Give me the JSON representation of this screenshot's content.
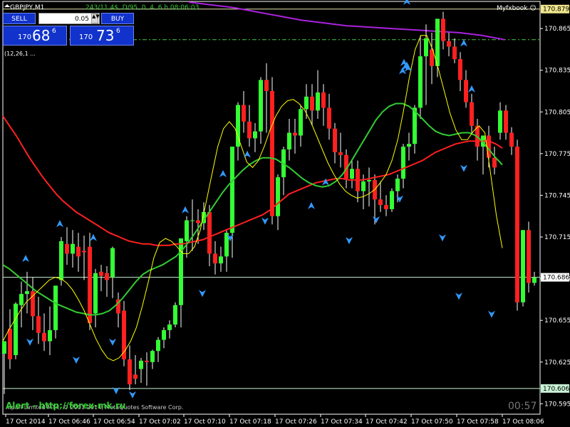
{
  "symbol_title": "GBPJPY,M1",
  "indicator_header": "243/11.4$, D/95,  0, 4, 6 h  08:06:03",
  "indicator_line2": "(12,26,1 ...",
  "account_label": "Myfxbook",
  "trade_panel": {
    "sell_label": "SELL",
    "buy_label": "BUY",
    "lot_value": "0.05",
    "sell_price_prefix": "170",
    "sell_price_big": "68",
    "sell_price_sup": "6",
    "buy_price_prefix": "170",
    "buy_price_big": "73",
    "buy_price_sup": "6"
  },
  "price_axis": {
    "ticks": [
      "170.865",
      "170.835",
      "170.805",
      "170.775",
      "170.745",
      "170.715",
      "170.685",
      "170.655",
      "170.625",
      "170.595"
    ],
    "ylim": [
      170.5875,
      170.8845
    ]
  },
  "price_tags": {
    "upper_line": "170.879",
    "current": "170.686",
    "lower_line": "170.606"
  },
  "time_axis": {
    "labels": [
      "17 Oct 2014",
      "17 Oct 06:46",
      "17 Oct 06:54",
      "17 Oct 07:02",
      "17 Oct 07:10",
      "17 Oct 07:18",
      "17 Oct 07:26",
      "17 Oct 07:34",
      "17 Oct 07:42",
      "17 Oct 07:50",
      "17 Oct 07:58",
      "17 Oct 08:06"
    ]
  },
  "alert_text": "Alert - http://forex-mk.ru",
  "copyright_text": "Alpari Limited MT4, © 2001-2014, MetaQuotes Software Corp.",
  "countdown": "00:57",
  "colors": {
    "bull": "#33ff33",
    "bear": "#ff2020",
    "wick": "#ffffff",
    "ma_slow": "#ff2020",
    "ma_mid": "#33cc33",
    "ma_fast": "#ffff00",
    "ma_long": "#aa22dd",
    "arrow": "#3399ff",
    "axis": "#ffffff",
    "level_line": "#c9f2d6",
    "lower_tag": "#c9f2d6",
    "bg": "#000000"
  },
  "chart_data": {
    "type": "candlestick",
    "symbol": "GBPJPY",
    "timeframe": "M1",
    "ylim": [
      170.5875,
      170.8845
    ],
    "candles": [
      {
        "o": 170.631,
        "h": 170.64,
        "c": 170.64,
        "l": 170.602
      },
      {
        "o": 170.649,
        "h": 170.663,
        "c": 170.627,
        "l": 170.62
      },
      {
        "o": 170.63,
        "h": 170.668,
        "c": 170.667,
        "l": 170.627
      },
      {
        "o": 170.666,
        "h": 170.683,
        "c": 170.674,
        "l": 170.65
      },
      {
        "o": 170.674,
        "h": 170.69,
        "c": 170.676,
        "l": 170.66
      },
      {
        "o": 170.676,
        "h": 170.686,
        "c": 170.658,
        "l": 170.648
      },
      {
        "o": 170.658,
        "h": 170.672,
        "c": 170.646,
        "l": 170.638
      },
      {
        "o": 170.646,
        "h": 170.66,
        "c": 170.64,
        "l": 170.633
      },
      {
        "o": 170.64,
        "h": 170.665,
        "c": 170.648,
        "l": 170.63
      },
      {
        "o": 170.648,
        "h": 170.67,
        "c": 170.68,
        "l": 170.642
      },
      {
        "o": 170.684,
        "h": 170.715,
        "c": 170.712,
        "l": 170.68
      },
      {
        "o": 170.71,
        "h": 170.722,
        "c": 170.703,
        "l": 170.695
      },
      {
        "o": 170.703,
        "h": 170.72,
        "c": 170.71,
        "l": 170.693
      },
      {
        "o": 170.708,
        "h": 170.718,
        "c": 170.701,
        "l": 170.69
      },
      {
        "o": 170.705,
        "h": 170.716,
        "c": 170.704,
        "l": 170.684
      },
      {
        "o": 170.708,
        "h": 170.718,
        "c": 170.653,
        "l": 170.648
      },
      {
        "o": 170.66,
        "h": 170.692,
        "c": 170.689,
        "l": 170.65
      },
      {
        "o": 170.69,
        "h": 170.695,
        "c": 170.687,
        "l": 170.676
      },
      {
        "o": 170.689,
        "h": 170.694,
        "c": 170.684,
        "l": 170.672
      },
      {
        "o": 170.686,
        "h": 170.708,
        "c": 170.707,
        "l": 170.671
      },
      {
        "o": 170.67,
        "h": 170.675,
        "c": 170.66,
        "l": 170.65
      },
      {
        "o": 170.662,
        "h": 170.669,
        "c": 170.627,
        "l": 170.622
      },
      {
        "o": 170.627,
        "h": 170.637,
        "c": 170.609,
        "l": 170.605
      },
      {
        "o": 170.616,
        "h": 170.63,
        "c": 170.613,
        "l": 170.609
      },
      {
        "o": 170.62,
        "h": 170.628,
        "c": 170.626,
        "l": 170.61
      },
      {
        "o": 170.626,
        "h": 170.632,
        "c": 170.625,
        "l": 170.608
      },
      {
        "o": 170.625,
        "h": 170.634,
        "c": 170.633,
        "l": 170.62
      },
      {
        "o": 170.633,
        "h": 170.643,
        "c": 170.641,
        "l": 170.625
      },
      {
        "o": 170.641,
        "h": 170.65,
        "c": 170.648,
        "l": 170.635
      },
      {
        "o": 170.648,
        "h": 170.655,
        "c": 170.652,
        "l": 170.642
      },
      {
        "o": 170.652,
        "h": 170.668,
        "c": 170.666,
        "l": 170.65
      },
      {
        "o": 170.666,
        "h": 170.714,
        "c": 170.714,
        "l": 170.65
      },
      {
        "o": 170.712,
        "h": 170.73,
        "c": 170.727,
        "l": 170.7
      },
      {
        "o": 170.727,
        "h": 170.742,
        "c": 170.727,
        "l": 170.705
      },
      {
        "o": 170.727,
        "h": 170.735,
        "c": 170.725,
        "l": 170.71
      },
      {
        "o": 170.725,
        "h": 170.74,
        "c": 170.733,
        "l": 170.72
      },
      {
        "o": 170.733,
        "h": 170.738,
        "c": 170.703,
        "l": 170.694
      },
      {
        "o": 170.703,
        "h": 170.712,
        "c": 170.696,
        "l": 170.688
      },
      {
        "o": 170.696,
        "h": 170.708,
        "c": 170.701,
        "l": 170.69
      },
      {
        "o": 170.701,
        "h": 170.72,
        "c": 170.718,
        "l": 170.69
      },
      {
        "o": 170.718,
        "h": 170.78,
        "c": 170.78,
        "l": 170.7
      },
      {
        "o": 170.78,
        "h": 170.812,
        "c": 170.81,
        "l": 170.77
      },
      {
        "o": 170.81,
        "h": 170.82,
        "c": 170.798,
        "l": 170.79
      },
      {
        "o": 170.798,
        "h": 170.81,
        "c": 170.786,
        "l": 170.78
      },
      {
        "o": 170.786,
        "h": 170.797,
        "c": 170.791,
        "l": 170.776
      },
      {
        "o": 170.791,
        "h": 170.83,
        "c": 170.828,
        "l": 170.782
      },
      {
        "o": 170.828,
        "h": 170.84,
        "c": 170.82,
        "l": 170.79
      },
      {
        "o": 170.82,
        "h": 170.83,
        "c": 170.73,
        "l": 170.724
      },
      {
        "o": 170.73,
        "h": 170.76,
        "c": 170.758,
        "l": 170.72
      },
      {
        "o": 170.758,
        "h": 170.78,
        "c": 170.778,
        "l": 170.745
      },
      {
        "o": 170.778,
        "h": 170.8,
        "c": 170.79,
        "l": 170.77
      },
      {
        "o": 170.79,
        "h": 170.8,
        "c": 170.788,
        "l": 170.775
      },
      {
        "o": 170.788,
        "h": 170.81,
        "c": 170.807,
        "l": 170.78
      },
      {
        "o": 170.807,
        "h": 170.825,
        "c": 170.816,
        "l": 170.8
      },
      {
        "o": 170.816,
        "h": 170.825,
        "c": 170.806,
        "l": 170.795
      },
      {
        "o": 170.806,
        "h": 170.835,
        "c": 170.819,
        "l": 170.8
      },
      {
        "o": 170.819,
        "h": 170.825,
        "c": 170.808,
        "l": 170.795
      },
      {
        "o": 170.808,
        "h": 170.818,
        "c": 170.793,
        "l": 170.785
      },
      {
        "o": 170.793,
        "h": 170.797,
        "c": 170.776,
        "l": 170.768
      },
      {
        "o": 170.776,
        "h": 170.79,
        "c": 170.774,
        "l": 170.765
      },
      {
        "o": 170.774,
        "h": 170.778,
        "c": 170.757,
        "l": 170.75
      },
      {
        "o": 170.757,
        "h": 170.77,
        "c": 170.764,
        "l": 170.75
      },
      {
        "o": 170.764,
        "h": 170.77,
        "c": 170.748,
        "l": 170.74
      },
      {
        "o": 170.748,
        "h": 170.76,
        "c": 170.755,
        "l": 170.735
      },
      {
        "o": 170.755,
        "h": 170.765,
        "c": 170.756,
        "l": 170.737
      },
      {
        "o": 170.756,
        "h": 170.76,
        "c": 170.742,
        "l": 170.724
      },
      {
        "o": 170.742,
        "h": 170.755,
        "c": 170.738,
        "l": 170.733
      },
      {
        "o": 170.738,
        "h": 170.745,
        "c": 170.735,
        "l": 170.73
      },
      {
        "o": 170.735,
        "h": 170.75,
        "c": 170.748,
        "l": 170.733
      },
      {
        "o": 170.748,
        "h": 170.76,
        "c": 170.757,
        "l": 170.74
      },
      {
        "o": 170.757,
        "h": 170.782,
        "c": 170.78,
        "l": 170.75
      },
      {
        "o": 170.78,
        "h": 170.79,
        "c": 170.782,
        "l": 170.77
      },
      {
        "o": 170.782,
        "h": 170.81,
        "c": 170.808,
        "l": 170.775
      },
      {
        "o": 170.808,
        "h": 170.86,
        "c": 170.845,
        "l": 170.8
      },
      {
        "o": 170.845,
        "h": 170.868,
        "c": 170.858,
        "l": 170.81
      },
      {
        "o": 170.85,
        "h": 170.862,
        "c": 170.838,
        "l": 170.825
      },
      {
        "o": 170.838,
        "h": 170.872,
        "c": 170.872,
        "l": 170.83
      },
      {
        "o": 170.872,
        "h": 170.877,
        "c": 170.856,
        "l": 170.85
      },
      {
        "o": 170.856,
        "h": 170.862,
        "c": 170.852,
        "l": 170.845
      },
      {
        "o": 170.852,
        "h": 170.858,
        "c": 170.843,
        "l": 170.84
      },
      {
        "o": 170.843,
        "h": 170.848,
        "c": 170.828,
        "l": 170.82
      },
      {
        "o": 170.828,
        "h": 170.835,
        "c": 170.812,
        "l": 170.808
      },
      {
        "o": 170.812,
        "h": 170.818,
        "c": 170.795,
        "l": 170.79
      },
      {
        "o": 170.795,
        "h": 170.8,
        "c": 170.78,
        "l": 170.77
      },
      {
        "o": 170.78,
        "h": 170.785,
        "c": 170.788,
        "l": 170.76
      },
      {
        "o": 170.788,
        "h": 170.795,
        "c": 170.772,
        "l": 170.765
      },
      {
        "o": 170.772,
        "h": 170.78,
        "c": 170.765,
        "l": 170.76
      },
      {
        "o": 170.79,
        "h": 170.812,
        "c": 170.806,
        "l": 170.785
      },
      {
        "o": 170.806,
        "h": 170.81,
        "c": 170.79,
        "l": 170.785
      },
      {
        "o": 170.79,
        "h": 170.794,
        "c": 170.78,
        "l": 170.774
      },
      {
        "o": 170.78,
        "h": 170.785,
        "c": 170.668,
        "l": 170.662
      },
      {
        "o": 170.668,
        "h": 170.672,
        "c": 170.72,
        "l": 170.665
      },
      {
        "o": 170.72,
        "h": 170.726,
        "c": 170.682,
        "l": 170.675
      },
      {
        "o": 170.682,
        "h": 170.69,
        "c": 170.686,
        "l": 170.68
      }
    ],
    "series": [
      {
        "name": "",
        "color_key": "ma_slow",
        "values": [
          170.802,
          170.795,
          170.788,
          170.78,
          170.772,
          170.765,
          170.758,
          170.752,
          170.746,
          170.741,
          170.737,
          170.733,
          170.73,
          170.727,
          170.724,
          170.721,
          170.718,
          170.716,
          170.714,
          170.712,
          170.711,
          170.71,
          170.71,
          170.709,
          170.709,
          170.709,
          170.71,
          170.71,
          170.711,
          170.712,
          170.713,
          170.715,
          170.717,
          170.719,
          170.721,
          170.723,
          170.725,
          170.727,
          170.729,
          170.731,
          170.734,
          170.738,
          170.742,
          170.746,
          170.748,
          170.75,
          170.752,
          170.754,
          170.755,
          170.756,
          170.757,
          170.757,
          170.756,
          170.756,
          170.756,
          170.757,
          170.758,
          170.759,
          170.76,
          170.762,
          170.764,
          170.766,
          170.768,
          170.77,
          170.773,
          170.776,
          170.778,
          170.78,
          170.782,
          170.783,
          170.784,
          170.784,
          170.784,
          170.784,
          170.782,
          170.779
        ]
      },
      {
        "name": "",
        "color_key": "ma_mid",
        "values": [
          170.695,
          170.692,
          170.688,
          170.684,
          170.68,
          170.676,
          170.673,
          170.67,
          170.667,
          170.665,
          170.663,
          170.661,
          170.66,
          170.659,
          170.659,
          170.66,
          170.662,
          170.666,
          170.671,
          170.677,
          170.683,
          170.688,
          170.691,
          170.693,
          170.695,
          170.698,
          170.701,
          170.706,
          170.712,
          170.719,
          170.726,
          170.733,
          170.74,
          170.747,
          170.753,
          170.758,
          170.763,
          170.767,
          170.77,
          170.772,
          170.772,
          170.771,
          170.768,
          170.765,
          170.761,
          170.757,
          170.754,
          170.752,
          170.751,
          170.752,
          170.755,
          170.76,
          170.767,
          170.775,
          170.783,
          170.791,
          170.799,
          170.805,
          170.809,
          170.811,
          170.811,
          170.809,
          170.805,
          170.8,
          170.795,
          170.791,
          170.789,
          170.788,
          170.789,
          170.79,
          170.79,
          170.788,
          170.784,
          170.778,
          170.772,
          170.767
        ]
      },
      {
        "name": "",
        "color_key": "ma_fast",
        "values": [
          170.64,
          170.648,
          170.655,
          170.662,
          170.668,
          170.672,
          170.676,
          170.68,
          170.684,
          170.686,
          170.685,
          170.682,
          170.677,
          170.67,
          170.662,
          170.652,
          170.642,
          170.634,
          170.628,
          170.626,
          170.628,
          170.633,
          170.64,
          170.65,
          170.665,
          170.682,
          170.7,
          170.711,
          170.714,
          170.712,
          170.708,
          170.703,
          170.703,
          170.708,
          170.72,
          170.74,
          170.76,
          170.78,
          170.793,
          170.798,
          170.793,
          170.781,
          170.769,
          170.765,
          170.77,
          170.78,
          170.792,
          170.802,
          170.809,
          170.813,
          170.814,
          170.811,
          170.806,
          170.798,
          170.788,
          170.778,
          170.768,
          170.76,
          170.753,
          170.748,
          170.745,
          170.743,
          170.744,
          170.746,
          170.749,
          170.754,
          170.76,
          170.77,
          170.785,
          170.806,
          170.83,
          170.85,
          170.86,
          170.86,
          170.85,
          170.836,
          170.82,
          170.804,
          170.792,
          170.785,
          170.785,
          170.791,
          170.795,
          170.79,
          170.76,
          170.73,
          170.707
        ]
      }
    ],
    "long_ma": [
      170.884,
      170.882,
      170.88,
      170.877,
      170.874,
      170.871,
      170.869,
      170.867,
      170.866,
      170.865,
      170.864,
      170.863,
      170.862,
      170.86,
      170.857
    ],
    "levels": [
      170.879,
      170.686,
      170.606,
      170.857
    ],
    "arrows_up": [
      [
        170.695
      ],
      [
        170.72
      ],
      [
        170.71
      ],
      [
        170.73
      ],
      [
        170.756
      ],
      [
        170.77
      ],
      [
        170.733
      ],
      [
        170.75
      ],
      [
        170.83
      ],
      [
        170.836
      ],
      [
        170.833
      ],
      [
        170.834
      ],
      [
        170.832
      ],
      [
        170.88
      ],
      [
        170.85
      ],
      [
        170.817
      ]
    ],
    "arrows_down": [
      [
        170.645
      ],
      [
        170.632
      ],
      [
        170.645
      ],
      [
        170.61
      ],
      [
        170.607
      ],
      [
        170.68
      ],
      [
        170.72
      ],
      [
        170.732
      ],
      [
        170.718
      ],
      [
        170.77
      ],
      [
        170.72
      ],
      [
        170.733
      ],
      [
        170.748
      ],
      [
        170.665
      ],
      [
        170.678
      ]
    ]
  }
}
